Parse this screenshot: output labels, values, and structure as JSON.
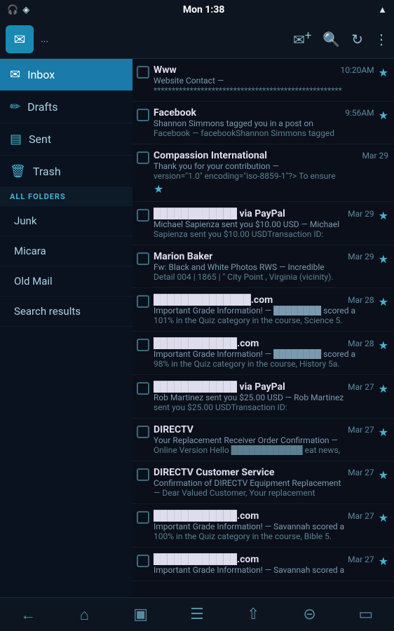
{
  "status_bar": {
    "left_icons": [
      "headphone-icon",
      "bluetooth-icon"
    ],
    "time": "Mon 1:38",
    "right_icons": [
      "wifi-icon"
    ]
  },
  "header": {
    "app_icon": "✉",
    "account_name": "...",
    "actions": {
      "compose_label": "✉+",
      "search_label": "🔍",
      "refresh_label": "↻",
      "more_label": "⋮"
    }
  },
  "sidebar": {
    "primary_items": [
      {
        "id": "inbox",
        "label": "Inbox",
        "icon": "✉",
        "active": true
      },
      {
        "id": "drafts",
        "label": "Drafts",
        "icon": "✏"
      },
      {
        "id": "sent",
        "label": "Sent",
        "icon": "🖥"
      },
      {
        "id": "trash",
        "label": "Trash",
        "icon": "🗑"
      }
    ],
    "section_header": "ALL FOLDERS",
    "subfolder_items": [
      {
        "id": "junk",
        "label": "Junk"
      },
      {
        "id": "micara",
        "label": "Micara"
      },
      {
        "id": "old-mail",
        "label": "Old Mail"
      },
      {
        "id": "search-results",
        "label": "Search results"
      }
    ]
  },
  "emails": [
    {
      "sender": "Www",
      "subject": "Website Contact —",
      "preview": "****************************************************",
      "time": "10:20AM",
      "starred": true
    },
    {
      "sender": "Facebook",
      "subject": "Shannon Simmons tagged you in a post on",
      "preview": "Facebook — facebookShannon Simmons tagged",
      "time": "9:56AM",
      "starred": true
    },
    {
      "sender": "Compassion International",
      "subject": "Thank you for your contribution — <?xml",
      "preview": "version=\"1.0\" encoding=\"iso-8859-1\"?> To ensure",
      "time": "Mar 29",
      "starred": true
    },
    {
      "sender": "████████████ via PayPal",
      "subject": "Michael Sapienza sent you $10.00 USD — Michael",
      "preview": "Sapienza sent you $10.00 USDTransaction ID:",
      "time": "Mar 29",
      "starred": true
    },
    {
      "sender": "Marion Baker",
      "subject": "Fw: Black and White Photos RWS — Incredible",
      "preview": "Detail 004 | 1865 | \" City Point , Virginia (vicinity).",
      "time": "Mar 29",
      "starred": true
    },
    {
      "sender": "██████████████.com",
      "subject": "Important Grade Information! — ████████ scored a",
      "preview": "101% in the Quiz category in the course, Science 5.",
      "time": "Mar 28",
      "starred": true
    },
    {
      "sender": "████████████.com",
      "subject": "Important Grade Information! — ████████ scored a",
      "preview": "98% in the Quiz category in the course, History 5a.",
      "time": "Mar 28",
      "starred": true
    },
    {
      "sender": "████████████ via PayPal",
      "subject": "Rob Martinez sent you $25.00 USD — Rob Martinez",
      "preview": "sent you $25.00 USDTransaction ID:",
      "time": "Mar 27",
      "starred": true
    },
    {
      "sender": "DIRECTV",
      "subject": "Your Replacement Receiver Order Confirmation —",
      "preview": "Online Version Hello ████████████ eat news,",
      "time": "Mar 27",
      "starred": true
    },
    {
      "sender": "DIRECTV Customer Service",
      "subject": "Confirmation of DIRECTV Equipment Replacement",
      "preview": "— Dear Valued Customer, Your replacement",
      "time": "Mar 27",
      "starred": true
    },
    {
      "sender": "████████████.com",
      "subject": "Important Grade Information! — Savannah scored a",
      "preview": "100% in the Quiz category in the course, Bible 5.",
      "time": "Mar 27",
      "starred": true
    },
    {
      "sender": "████████████.com",
      "subject": "Important Grade Information! — Savannah scored a",
      "preview": "",
      "time": "Mar 27",
      "starred": true
    }
  ],
  "bottom_nav": {
    "items": [
      {
        "id": "back",
        "icon": "←",
        "label": "back"
      },
      {
        "id": "home",
        "icon": "⌂",
        "label": "home"
      },
      {
        "id": "window",
        "icon": "▣",
        "label": "windows"
      },
      {
        "id": "menu",
        "icon": "☰",
        "label": "menu"
      },
      {
        "id": "share",
        "icon": "↑",
        "label": "share"
      },
      {
        "id": "bookmark",
        "icon": "⊡",
        "label": "bookmark"
      },
      {
        "id": "screen",
        "icon": "▭",
        "label": "screen"
      }
    ]
  }
}
